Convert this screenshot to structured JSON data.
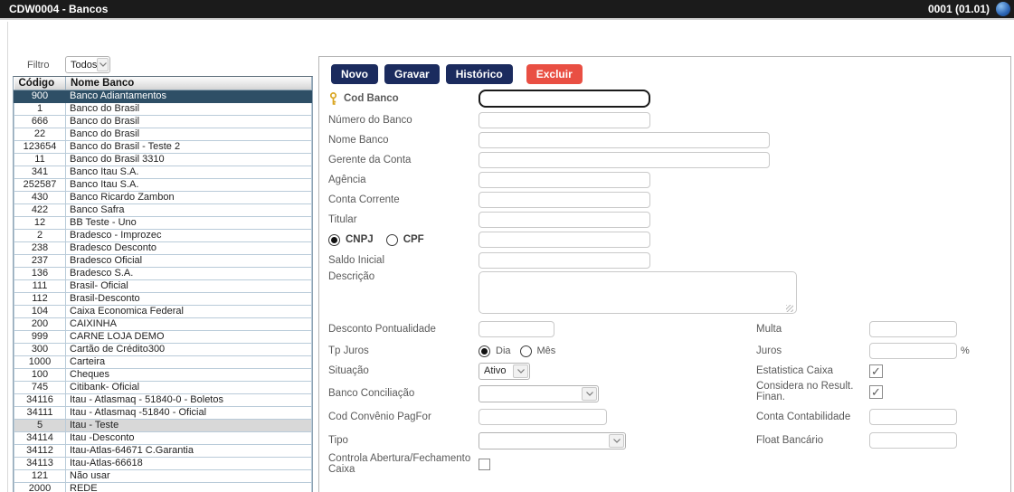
{
  "titlebar": {
    "title": "CDW0004 - Bancos",
    "version": "0001 (01.01)"
  },
  "colors": {
    "titlebar_bg": "#1b1b1b",
    "accent_navy": "#1b2b5e",
    "danger_red": "#e94f43",
    "selected_row_bg": "#2e4f66",
    "highlight_row_bg": "#d8d8d8"
  },
  "filter": {
    "label": "Filtro",
    "value": "Todos"
  },
  "bank_table": {
    "columns": {
      "code": "Código",
      "name": "Nome Banco"
    },
    "selected_code": "900",
    "highlight_code": "5",
    "rows": [
      {
        "code": "900",
        "name": "Banco Adiantamentos"
      },
      {
        "code": "1",
        "name": "Banco do Brasil"
      },
      {
        "code": "666",
        "name": "Banco do Brasil"
      },
      {
        "code": "22",
        "name": "Banco do Brasil"
      },
      {
        "code": "123654",
        "name": "Banco do Brasil - Teste 2"
      },
      {
        "code": "11",
        "name": "Banco do Brasil 3310"
      },
      {
        "code": "341",
        "name": "Banco Itau S.A."
      },
      {
        "code": "252587",
        "name": "Banco Itau S.A."
      },
      {
        "code": "430",
        "name": "Banco Ricardo Zambon"
      },
      {
        "code": "422",
        "name": "Banco Safra"
      },
      {
        "code": "12",
        "name": "BB Teste - Uno"
      },
      {
        "code": "2",
        "name": "Bradesco - Improzec"
      },
      {
        "code": "238",
        "name": "Bradesco Desconto"
      },
      {
        "code": "237",
        "name": "Bradesco Oficial"
      },
      {
        "code": "136",
        "name": "Bradesco S.A."
      },
      {
        "code": "111",
        "name": "Brasil- Oficial"
      },
      {
        "code": "112",
        "name": "Brasil-Desconto"
      },
      {
        "code": "104",
        "name": "Caixa Economica Federal"
      },
      {
        "code": "200",
        "name": "CAIXINHA"
      },
      {
        "code": "999",
        "name": "CARNE LOJA DEMO"
      },
      {
        "code": "300",
        "name": "Cartão de Crédito300"
      },
      {
        "code": "1000",
        "name": "Carteira"
      },
      {
        "code": "100",
        "name": "Cheques"
      },
      {
        "code": "745",
        "name": "Citibank- Oficial"
      },
      {
        "code": "34116",
        "name": "Itau - Atlasmaq - 51840-0 - Boletos"
      },
      {
        "code": "34111",
        "name": "Itau - Atlasmaq -51840 - Oficial"
      },
      {
        "code": "5",
        "name": "Itau - Teste"
      },
      {
        "code": "34114",
        "name": "Itau -Desconto"
      },
      {
        "code": "34112",
        "name": "Itau-Atlas-64671 C.Garantia"
      },
      {
        "code": "34113",
        "name": "Itau-Atlas-66618"
      },
      {
        "code": "121",
        "name": "Não usar"
      },
      {
        "code": "2000",
        "name": "REDE"
      }
    ]
  },
  "toolbar": {
    "novo": "Novo",
    "gravar": "Gravar",
    "historico": "Histórico",
    "excluir": "Excluir"
  },
  "form": {
    "cod_banco": {
      "label": "Cod Banco",
      "value": ""
    },
    "numero_banco": {
      "label": "Número do Banco",
      "value": ""
    },
    "nome_banco": {
      "label": "Nome Banco",
      "value": ""
    },
    "gerente": {
      "label": "Gerente da Conta",
      "value": ""
    },
    "agencia": {
      "label": "Agência",
      "value": ""
    },
    "conta_corrente": {
      "label": "Conta Corrente",
      "value": ""
    },
    "titular": {
      "label": "Titular",
      "value": ""
    },
    "doc_type": {
      "cnpj_label": "CNPJ",
      "cpf_label": "CPF",
      "cnpj_on": true,
      "cpf_on": false,
      "value": ""
    },
    "saldo_inicial": {
      "label": "Saldo Inicial",
      "value": ""
    },
    "descricao": {
      "label": "Descrição",
      "value": ""
    },
    "desconto_pontualidade": {
      "label": "Desconto Pontualidade",
      "value": ""
    },
    "tp_juros": {
      "label": "Tp Juros",
      "dia_label": "Dia",
      "mes_label": "Mês",
      "dia_on": true,
      "mes_on": false
    },
    "situacao": {
      "label": "Situação",
      "value": "Ativo"
    },
    "banco_conciliacao": {
      "label": "Banco Conciliação",
      "value": ""
    },
    "cod_convenio_pagfor": {
      "label": "Cod Convênio PagFor",
      "value": ""
    },
    "tipo": {
      "label": "Tipo",
      "value": ""
    },
    "controla_caixa": {
      "label": "Controla Abertura/Fechamento Caixa",
      "checked": false
    },
    "multa": {
      "label": "Multa",
      "value": ""
    },
    "juros": {
      "label": "Juros",
      "value": "",
      "suffix": "%"
    },
    "estatistica_caixa": {
      "label": "Estatistica Caixa",
      "checked": true
    },
    "considera_result": {
      "label": "Considera no Result. Finan.",
      "checked": true
    },
    "conta_contabilidade": {
      "label": "Conta Contabilidade",
      "value": ""
    },
    "float_bancario": {
      "label": "Float Bancário",
      "value": ""
    }
  }
}
